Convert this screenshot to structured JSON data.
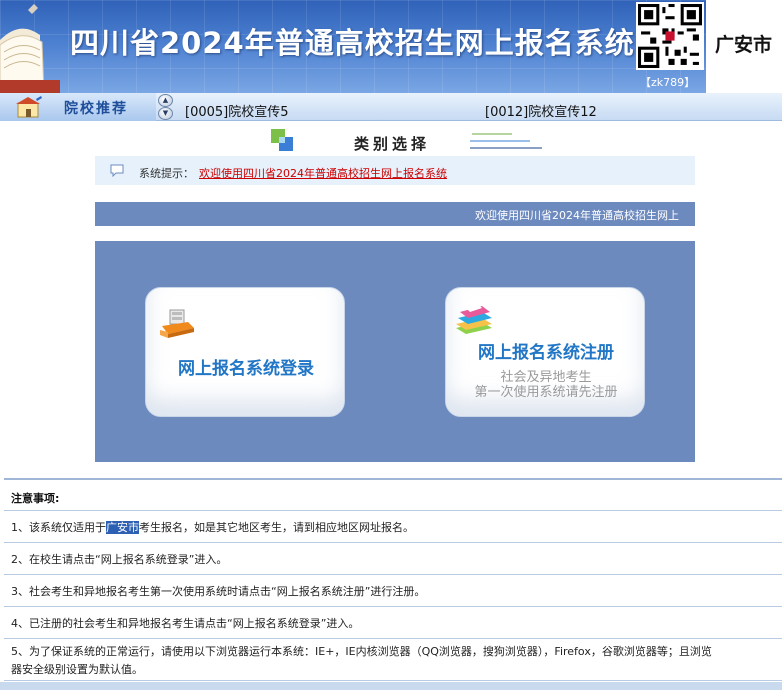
{
  "header": {
    "title": "四川省2024年普通高校招生网上报名系统",
    "qr_code_label": "【zk789】",
    "city": "广安市"
  },
  "recommend": {
    "title": "院校推荐",
    "items": [
      "[0005]院校宣传5",
      "[0012]院校宣传12"
    ]
  },
  "category": {
    "title": "类别选择"
  },
  "notice": {
    "label": "系统提示：",
    "text": "欢迎使用四川省2024年普通高校招生网上报名系统"
  },
  "marquee": {
    "text": "欢迎使用四川省2024年普通高校招生网上"
  },
  "cards": {
    "login_title": "网上报名系统登录",
    "register_title": "网上报名系统注册",
    "register_sub1": "社会及异地考生",
    "register_sub2": "第一次使用系统请先注册"
  },
  "notes": {
    "heading": "注意事项:",
    "item1_pre": "1、该系统仅适用于",
    "item1_city": "广安市",
    "item1_post": "考生报名，如是其它地区考生，请到相应地区网址报名。",
    "item2": "2、在校生请点击“网上报名系统登录”进入。",
    "item3": "3、社会考生和异地报名考生第一次使用系统时请点击“网上报名系统注册”进行注册。",
    "item4": "4、已注册的社会考生和异地报名考生请点击“网上报名系统登录”进入。",
    "item5_line1": "5、为了保证系统的正常运行，请使用以下浏览器运行本系统：IE+，IE内核浏览器（QQ浏览器，搜狗浏览器），Firefox，谷歌浏览器等；且浏览",
    "item5_line2": "器安全级别设置为默认值。"
  },
  "colors": {
    "header_blue": "#2f62b8",
    "panel_blue": "#6d8abf",
    "card_title_blue": "#2276c6",
    "notice_red": "#cc0000"
  }
}
